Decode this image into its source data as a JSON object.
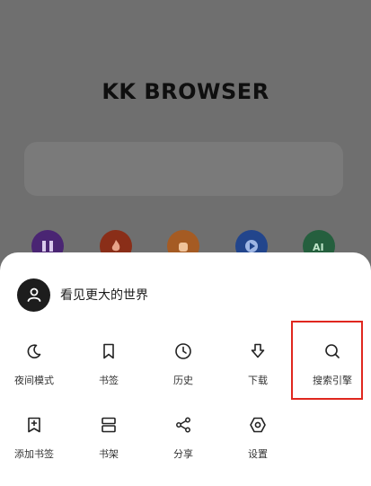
{
  "background": {
    "brand": "KK BROWSER",
    "shortcut_colors": [
      "#5a2a8a",
      "#a0371e",
      "#b1642a",
      "#2b4f96",
      "#2f6e4a"
    ]
  },
  "sheet": {
    "profile_name": "看见更大的世界",
    "menu": [
      {
        "label": "夜间模式",
        "icon": "moon-icon"
      },
      {
        "label": "书签",
        "icon": "bookmark-icon"
      },
      {
        "label": "历史",
        "icon": "clock-icon"
      },
      {
        "label": "下载",
        "icon": "download-icon"
      },
      {
        "label": "搜索引擎",
        "icon": "search-icon"
      },
      {
        "label": "添加书签",
        "icon": "add-bookmark-icon"
      },
      {
        "label": "书架",
        "icon": "bookshelf-icon"
      },
      {
        "label": "分享",
        "icon": "share-icon"
      },
      {
        "label": "设置",
        "icon": "settings-icon"
      }
    ],
    "highlight_color": "#e0271f"
  }
}
